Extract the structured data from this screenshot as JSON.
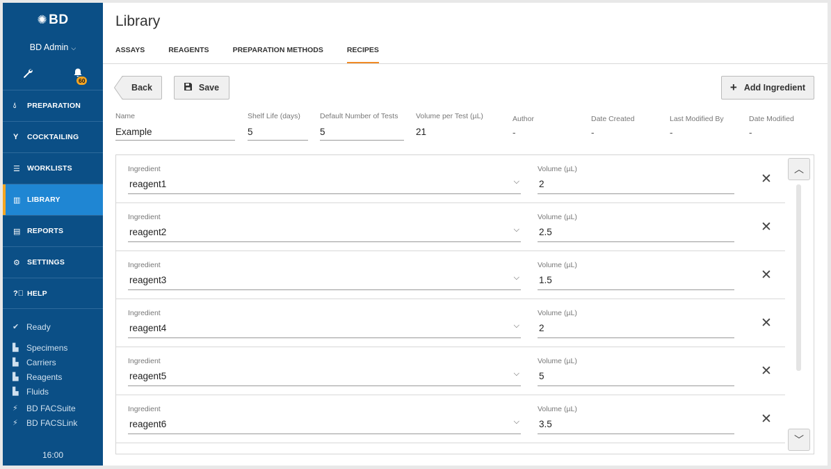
{
  "sidebar": {
    "brand": "BD",
    "user": "BD Admin",
    "notification_count": "60",
    "nav": [
      {
        "label": "PREPARATION"
      },
      {
        "label": "COCKTAILING"
      },
      {
        "label": "WORKLISTS"
      },
      {
        "label": "LIBRARY"
      },
      {
        "label": "REPORTS"
      },
      {
        "label": "SETTINGS"
      },
      {
        "label": "HELP"
      }
    ],
    "status": {
      "ready": "Ready",
      "specimens": "Specimens",
      "carriers": "Carriers",
      "reagents": "Reagents",
      "fluids": "Fluids",
      "facsuite": "BD FACSuite",
      "facslink": "BD FACSLink"
    },
    "time": "16:00"
  },
  "header": {
    "title": "Library",
    "tabs": [
      {
        "label": "ASSAYS"
      },
      {
        "label": "REAGENTS"
      },
      {
        "label": "PREPARATION METHODS"
      },
      {
        "label": "RECIPES"
      }
    ]
  },
  "toolbar": {
    "back_label": "Back",
    "save_label": "Save",
    "add_label": "Add Ingredient"
  },
  "recipe": {
    "name_label": "Name",
    "name_value": "Example",
    "shelf_label": "Shelf Life (days)",
    "shelf_value": "5",
    "tests_label": "Default Number of Tests",
    "tests_value": "5",
    "volume_label": "Volume per Test (µL)",
    "volume_value": "21",
    "author_label": "Author",
    "author_value": "-",
    "created_label": "Date Created",
    "created_value": "-",
    "modified_by_label": "Last Modified By",
    "modified_by_value": "-",
    "modified_label": "Date Modified",
    "modified_value": "-"
  },
  "ingredients": {
    "ingredient_label": "Ingredient",
    "volume_label": "Volume (µL)",
    "rows": [
      {
        "ingredient": "reagent1",
        "volume": "2"
      },
      {
        "ingredient": "reagent2",
        "volume": "2.5"
      },
      {
        "ingredient": "reagent3",
        "volume": "1.5"
      },
      {
        "ingredient": "reagent4",
        "volume": "2"
      },
      {
        "ingredient": "reagent5",
        "volume": "5"
      },
      {
        "ingredient": "reagent6",
        "volume": "3.5"
      }
    ]
  },
  "colors": {
    "sidebar": "#0b4f86",
    "active_nav": "#1f86d3",
    "accent": "#f08a24",
    "badge": "#f5a623"
  }
}
